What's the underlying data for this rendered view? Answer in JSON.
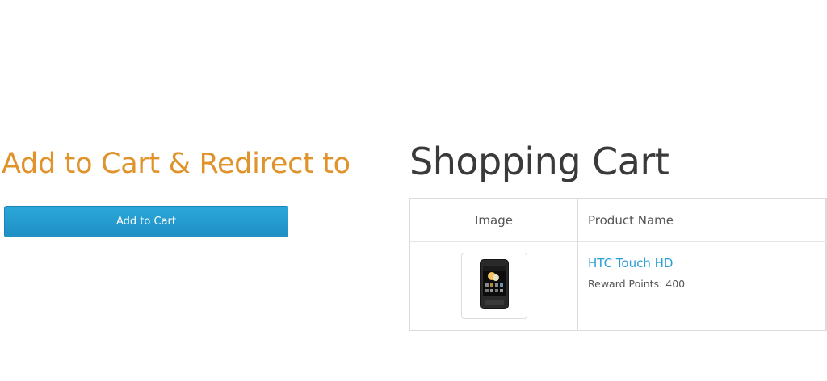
{
  "promo": {
    "heading": "Add to Cart & Redirect to",
    "button_label": "Add to Cart"
  },
  "cart": {
    "title": "Shopping Cart",
    "columns": [
      "Image",
      "Product Name"
    ],
    "items": [
      {
        "name": "HTC Touch HD",
        "reward_points": "Reward Points: 400",
        "image_icon": "phone-icon"
      }
    ]
  },
  "colors": {
    "heading_orange": "#e0932a",
    "button_blue": "#2ba7da",
    "link_blue": "#2a9fd6",
    "title_text": "#3a3a3a"
  }
}
